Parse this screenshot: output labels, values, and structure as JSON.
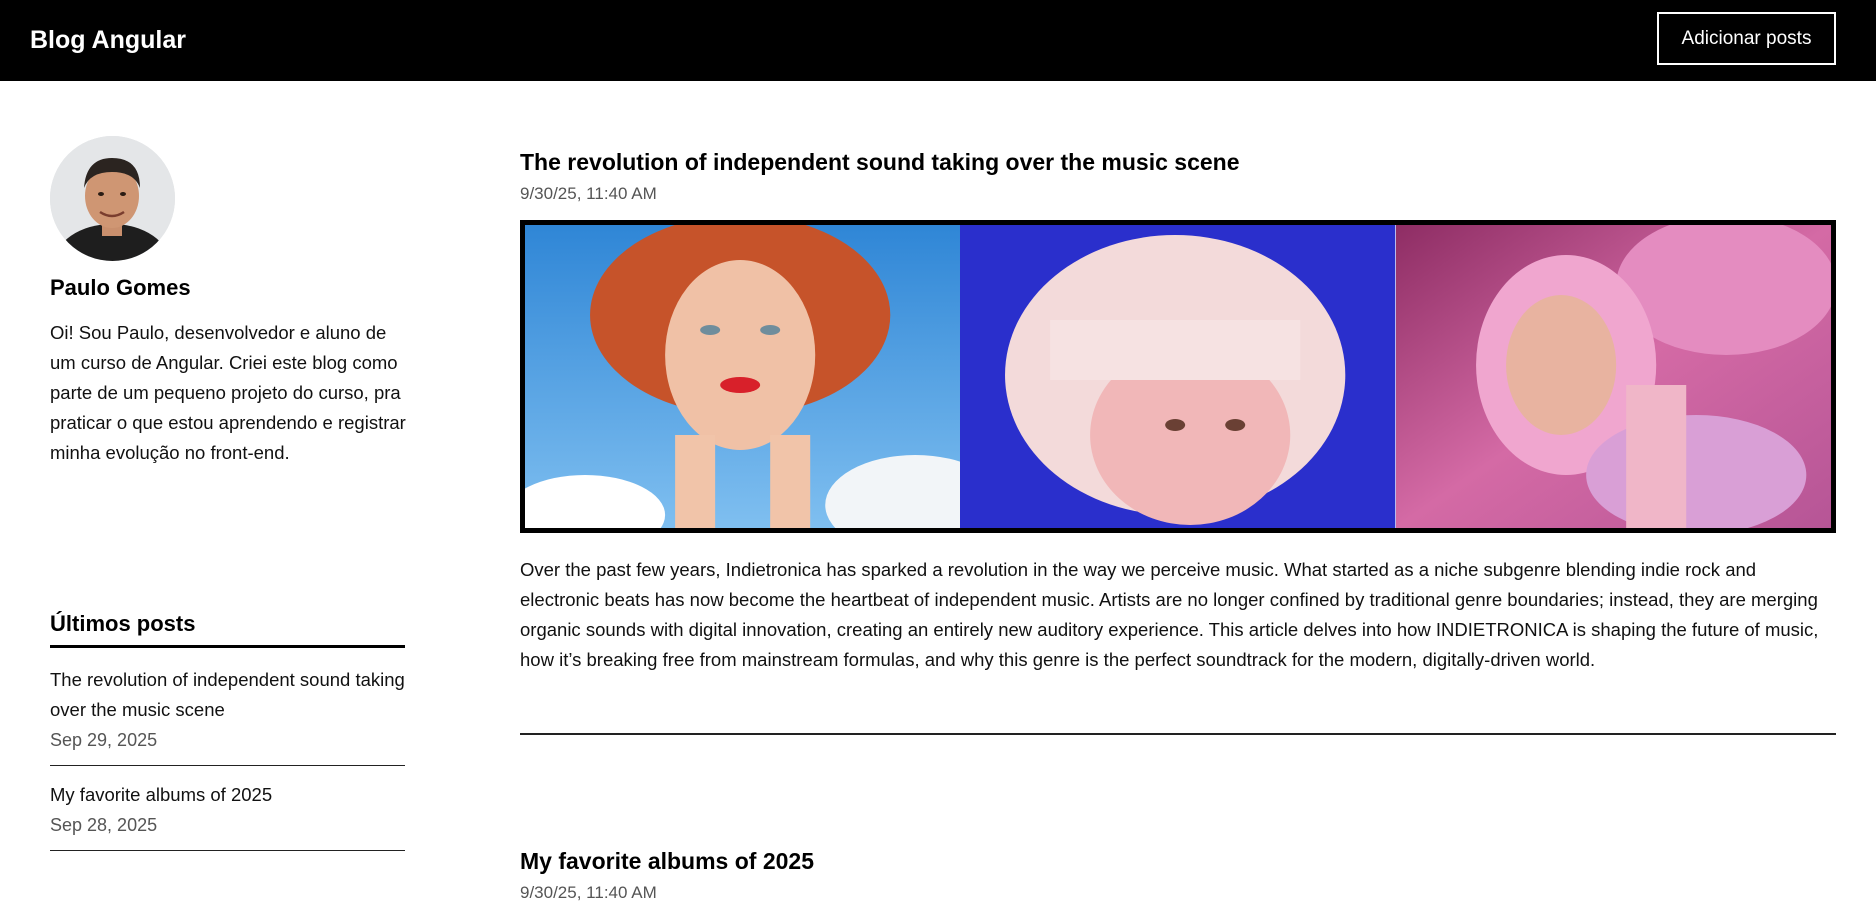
{
  "header": {
    "brand": "Blog Angular",
    "add_button_label": "Adicionar posts"
  },
  "sidebar": {
    "author_name": "Paulo Gomes",
    "author_bio": "Oi! Sou Paulo, desenvolvedor e aluno de um curso de Angular. Criei este blog como parte de um pequeno projeto do curso, pra praticar o que estou aprendendo e registrar minha evolução no front-end.",
    "recent_title": "Últimos posts",
    "recent_posts": [
      {
        "title": "The revolution of independent sound taking over the music scene",
        "date": "Sep 29, 2025"
      },
      {
        "title": "My favorite albums of 2025",
        "date": "Sep 28, 2025"
      }
    ]
  },
  "posts": [
    {
      "title": "The revolution of independent sound taking over the music scene",
      "date": "9/30/25, 11:40 AM",
      "body": "Over the past few years, Indietronica has sparked a revolution in the way we perceive music. What started as a niche subgenre blending indie rock and electronic beats has now become the heartbeat of independent music. Artists are no longer confined by traditional genre boundaries; instead, they are merging organic sounds with digital innovation, creating an entirely new auditory experience. This article delves into how INDIETRONICA is shaping the future of music, how it’s breaking free from mainstream formulas, and why this genre is the perfect soundtrack for the modern, digitally-driven world."
    },
    {
      "title": "My favorite albums of 2025",
      "date": "9/30/25, 11:40 AM"
    }
  ],
  "colors": {
    "header_bg": "#000000",
    "panel_sky": "#3a8fd8",
    "panel_blue": "#2f2fcf",
    "panel_pink": "#c2578f"
  }
}
